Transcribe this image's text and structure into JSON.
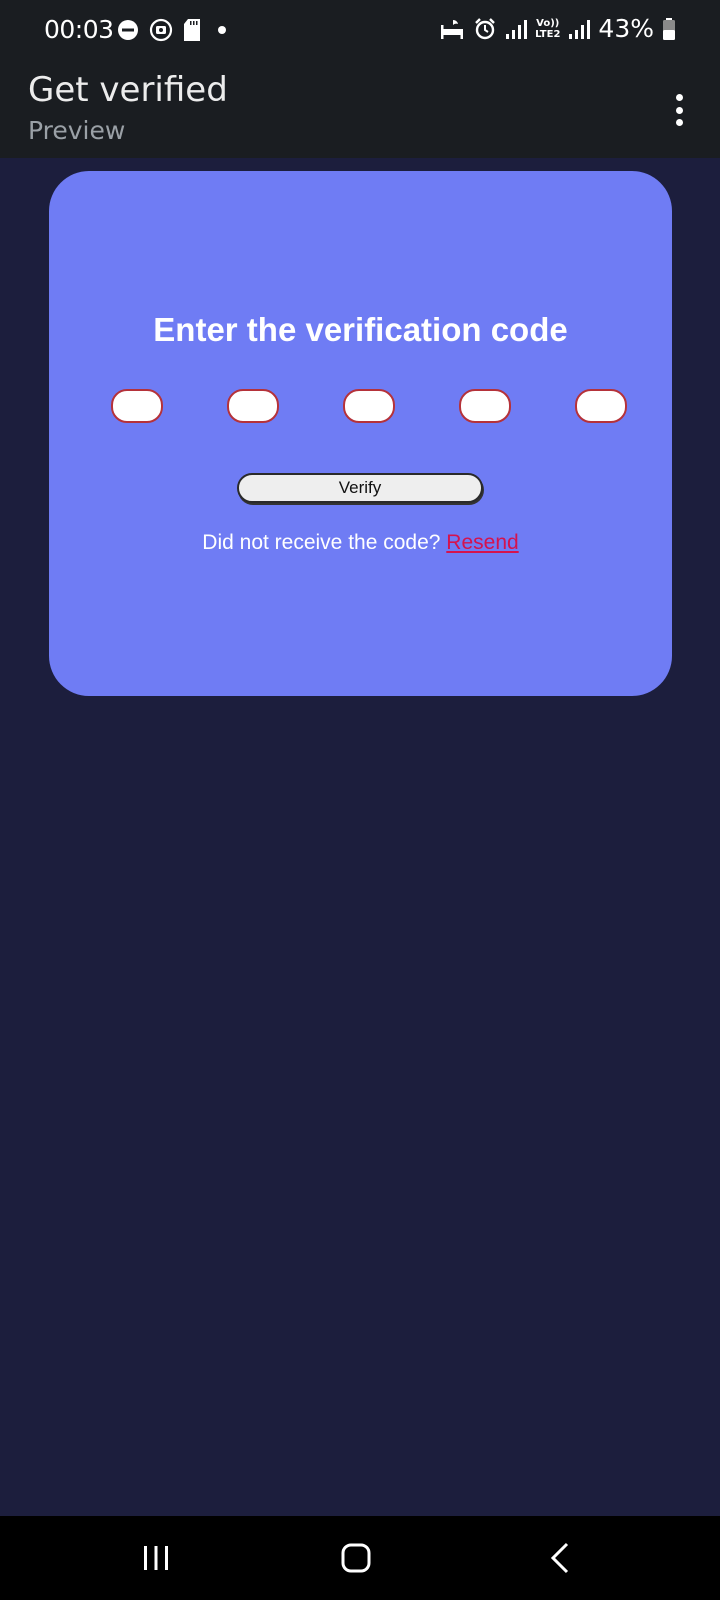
{
  "status_bar": {
    "time": "00:03",
    "battery_percent": "43%",
    "left_icons": [
      "dnd-icon",
      "cast-icon",
      "sd-card-icon",
      "dot-icon"
    ],
    "right_icons": [
      "sleep-icon",
      "alarm-icon",
      "signal-1-icon",
      "volte-lte2-icon",
      "signal-2-icon",
      "battery-icon"
    ],
    "volte_text": "Vo))",
    "lte_text": "LTE2"
  },
  "app_bar": {
    "title": "Get verified",
    "subtitle": "Preview",
    "menu_icon": "more-vert-icon"
  },
  "card": {
    "heading": "Enter the verification code",
    "code_fields": [
      {
        "value": ""
      },
      {
        "value": ""
      },
      {
        "value": ""
      },
      {
        "value": ""
      },
      {
        "value": ""
      }
    ],
    "verify_label": "Verify",
    "resend_prompt": "Did not receive the code?",
    "resend_label": "Resend"
  },
  "nav_bar": {
    "icons": [
      "recents-icon",
      "home-icon",
      "back-icon"
    ]
  },
  "colors": {
    "background": "#1c1e3d",
    "app_bar": "#1a1d21",
    "card": "#6f7cf4",
    "code_border": "#b5323a",
    "resend_link": "#d4134e"
  }
}
